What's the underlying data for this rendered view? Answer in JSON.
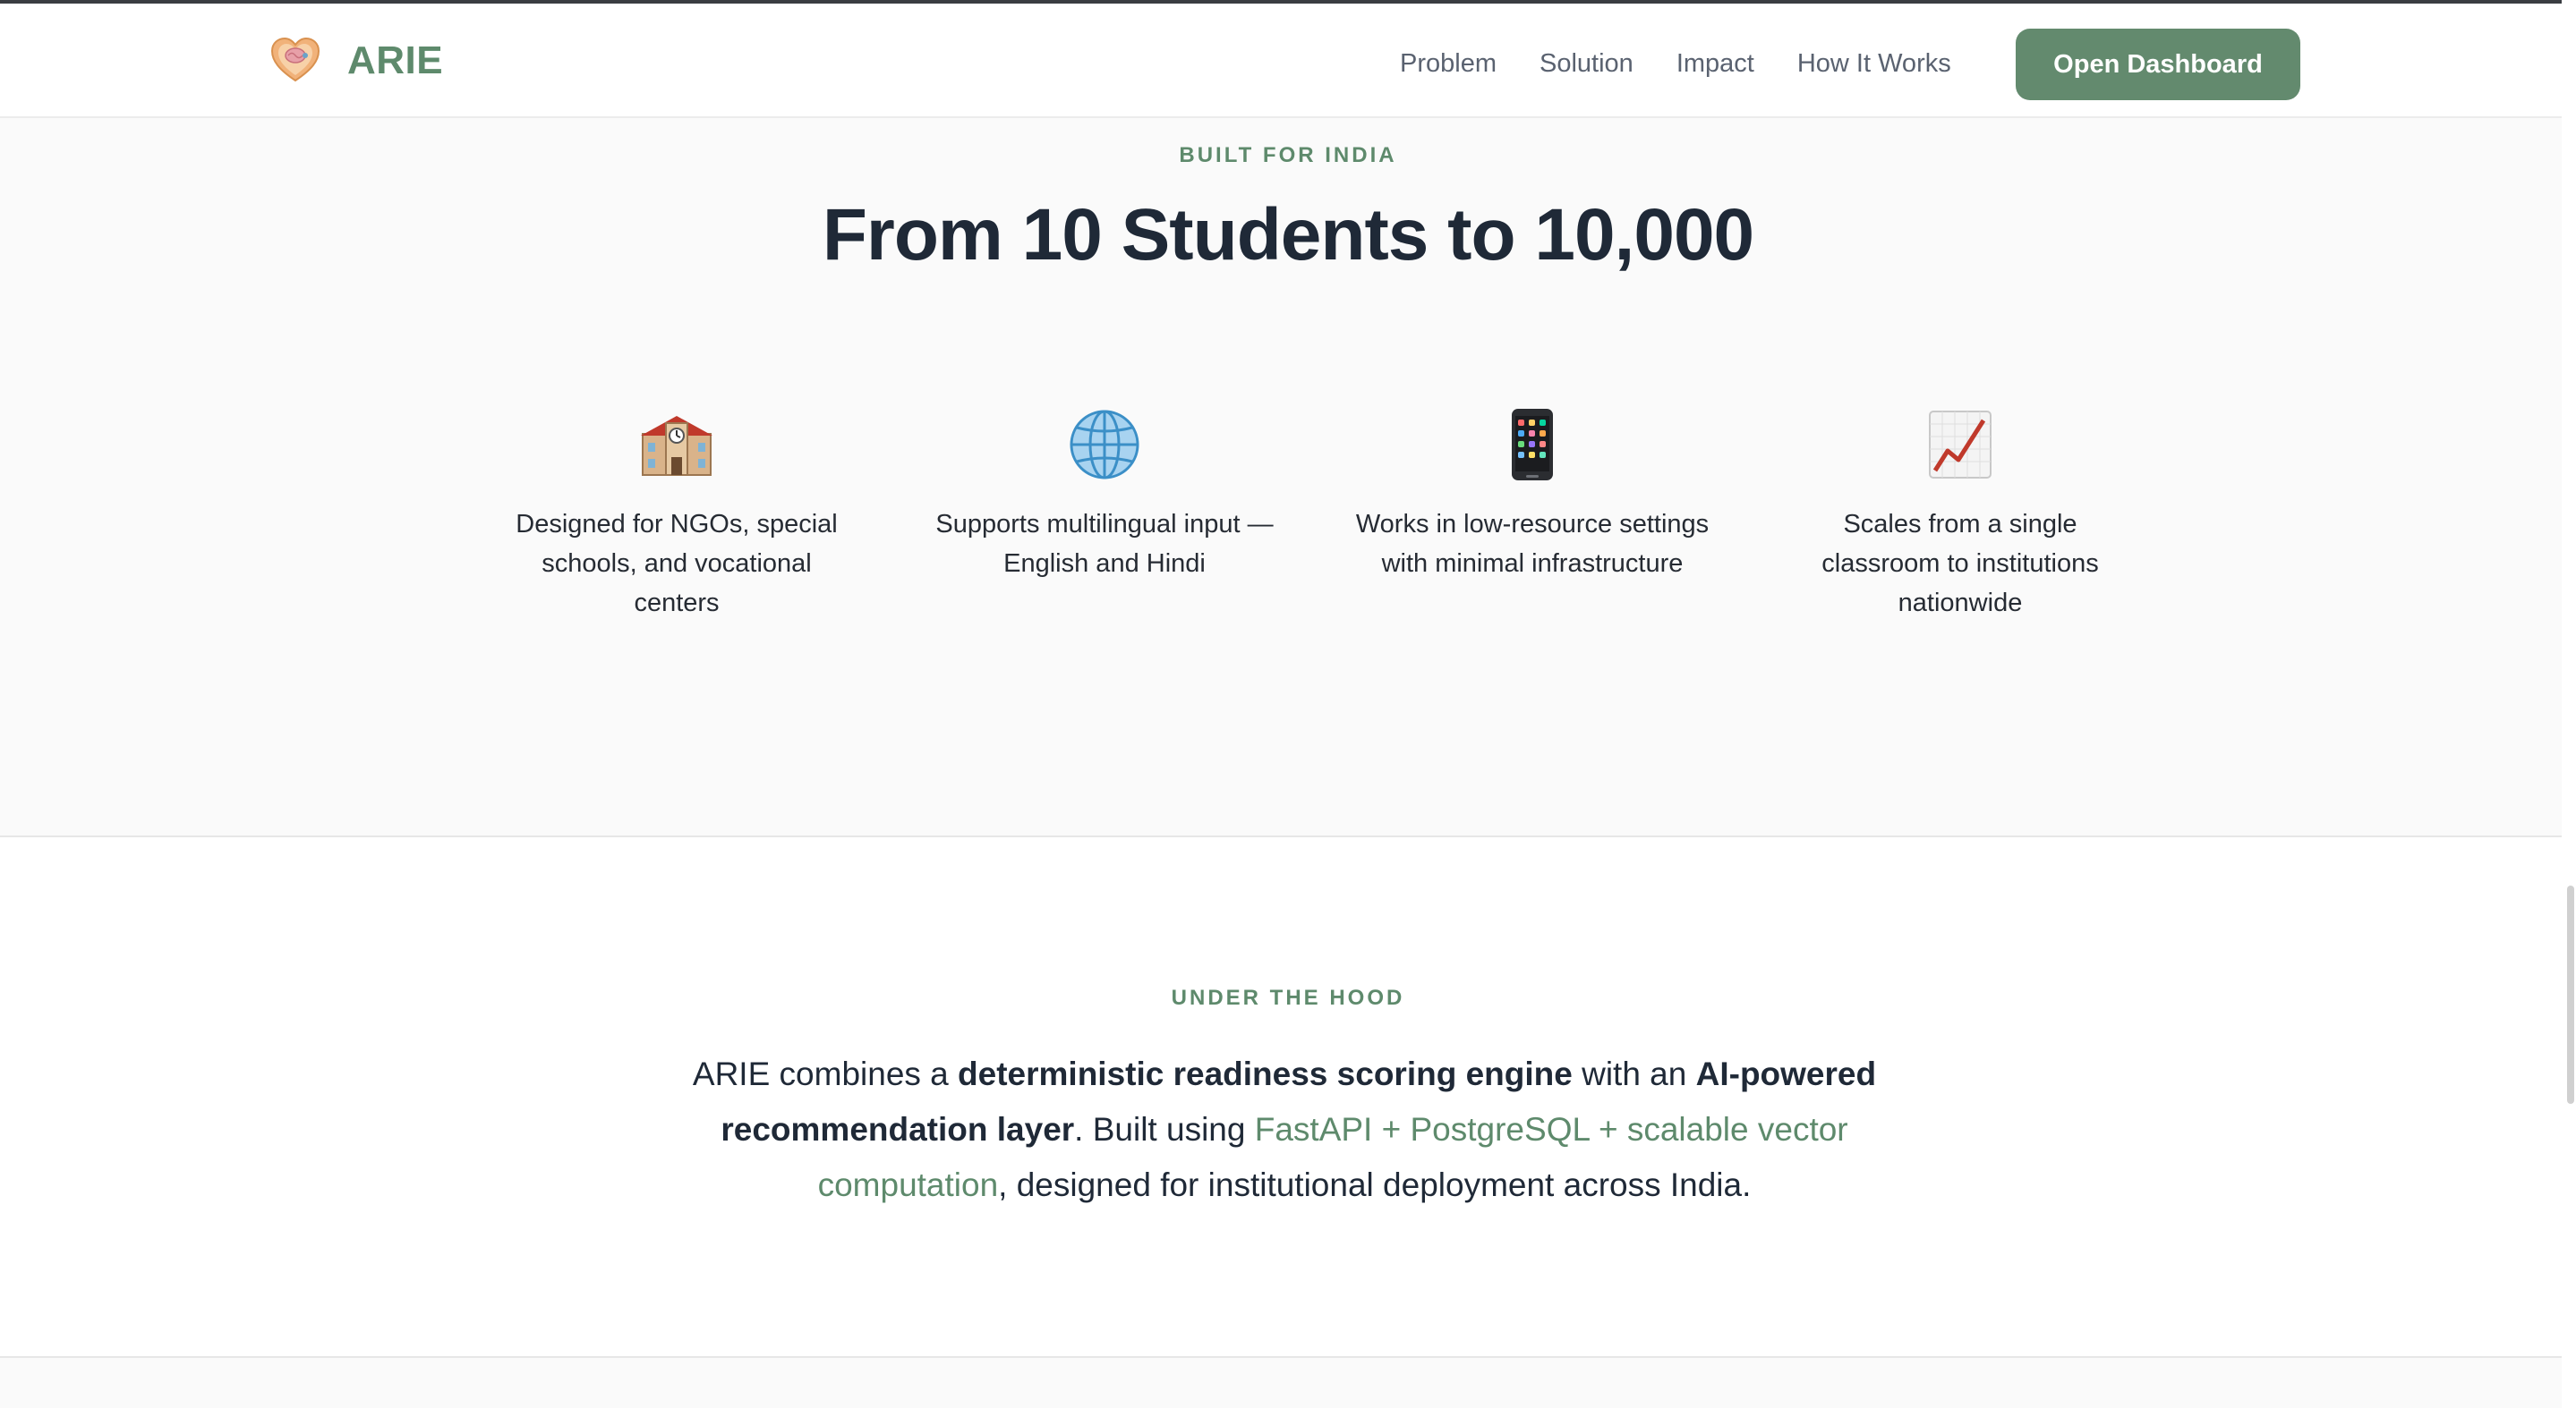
{
  "header": {
    "brand": "ARIE",
    "logo_icon": "heart-brain-icon",
    "nav": [
      "Problem",
      "Solution",
      "Impact",
      "How It Works"
    ],
    "cta_label": "Open Dashboard"
  },
  "india": {
    "eyebrow": "BUILT FOR INDIA",
    "headline": "From 10 Students to 10,000",
    "features": [
      {
        "icon": "school-building-icon",
        "text": "Designed for NGOs, special schools, and vocational centers"
      },
      {
        "icon": "globe-icon",
        "text": "Supports multilingual input — English and Hindi"
      },
      {
        "icon": "mobile-phone-icon",
        "text": "Works in low-resource settings with minimal infrastructure"
      },
      {
        "icon": "chart-increasing-icon",
        "text": "Scales from a single classroom to institutions nationwide"
      }
    ]
  },
  "hood": {
    "eyebrow": "UNDER THE HOOD",
    "text_1": "ARIE combines a ",
    "bold_1": "deterministic readiness scoring engine",
    "text_2": " with an ",
    "bold_2": "AI-powered recommendation layer",
    "text_3": ". Built using ",
    "tech": "FastAPI + PostgreSQL + scalable vector computation",
    "text_4": ", designed for institutional deployment across India."
  },
  "colors": {
    "accent": "#5e8a6c",
    "button": "#638a6e",
    "heading": "#1f2937",
    "section_bg": "#fafafa"
  }
}
